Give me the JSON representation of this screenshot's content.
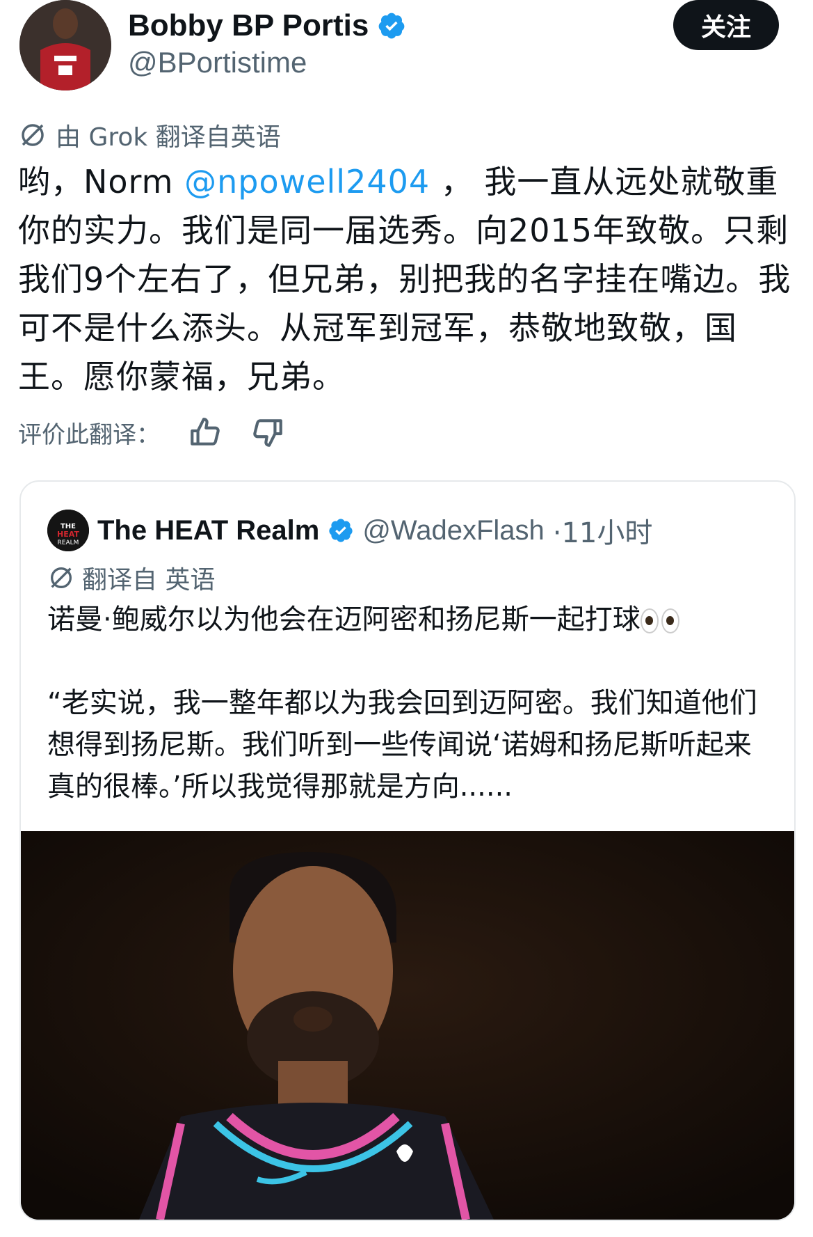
{
  "author": {
    "display_name": "Bobby BP Portis",
    "handle": "@BPortistime",
    "follow_label": "关注"
  },
  "translation": {
    "note": "由 Grok 翻译自英语"
  },
  "tweet": {
    "text_before_mention": "哟，Norm ",
    "mention": "@npowell2404",
    "text_after_mention": " ， 我一直从远处就敬重你的实力。我们是同一届选秀。向2015年致敬。只剩我们9个左右了，但兄弟，别把我的名字挂在嘴边。我可不是什么添头。从冠军到冠军，恭敬地致敬，国王。愿你蒙福，兄弟。"
  },
  "rating": {
    "label": "评价此翻译："
  },
  "quote": {
    "display_name": "The HEAT Realm",
    "handle": "@WadexFlash",
    "time": "·11小时",
    "translation_note": "翻译自 英语",
    "line1": "诺曼·鲍威尔以为他会在迈阿密和扬尼斯一起打球",
    "line2": "“老实说，我一整年都以为我会回到迈阿密。我们知道他们想得到扬尼斯。我们听到一些传闻说‘诺姆和扬尼斯听起来真的很棒。’所以我觉得那就是方向......"
  },
  "colors": {
    "accent": "#1d9bf0",
    "text": "#0f1419",
    "muted": "#536471",
    "follow_bg": "#0f1419"
  }
}
